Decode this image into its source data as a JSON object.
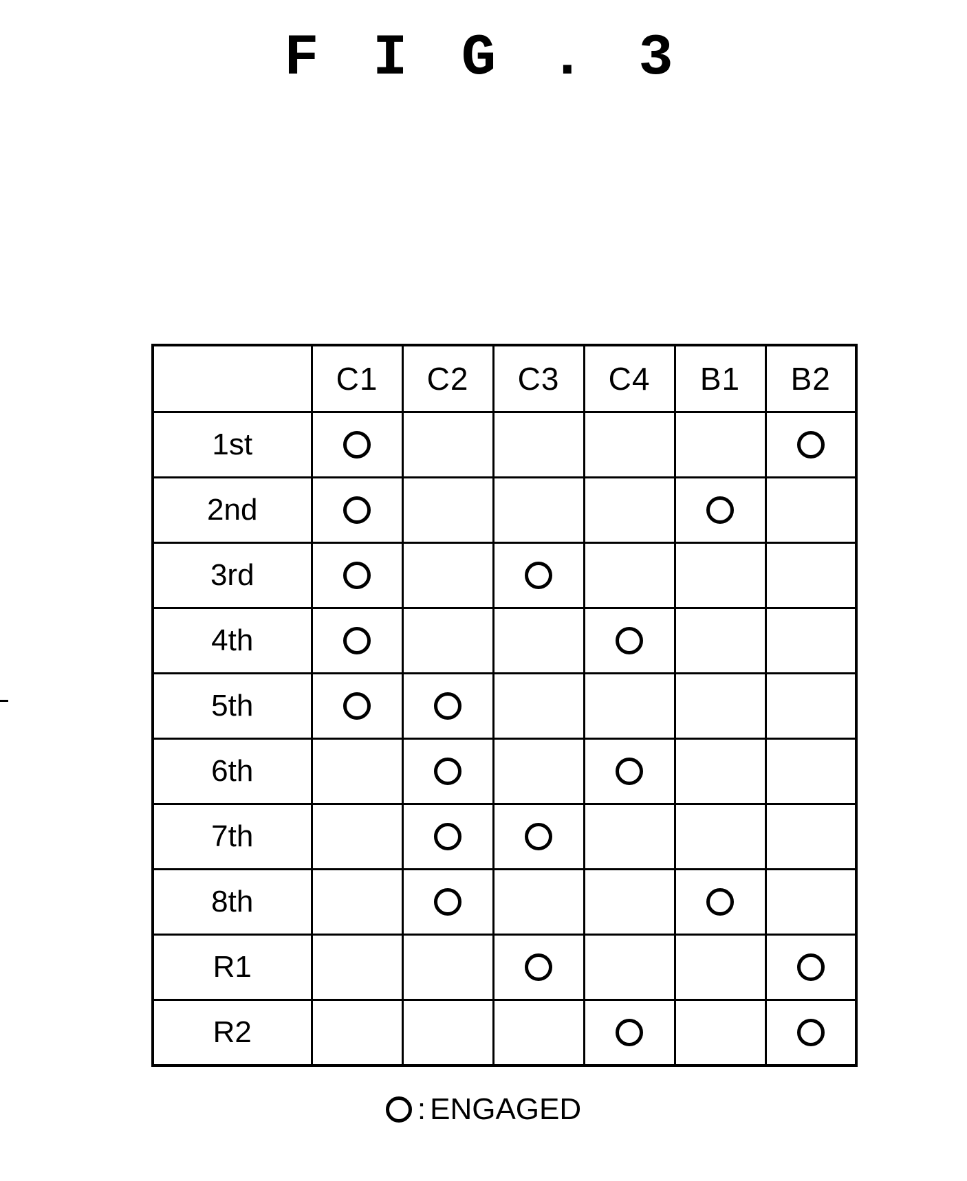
{
  "figure": {
    "title": "F I G . 3"
  },
  "table": {
    "corner_label": "",
    "columns": [
      "C1",
      "C2",
      "C3",
      "C4",
      "B1",
      "B2"
    ],
    "rows": [
      {
        "label": "1st",
        "engaged": [
          "C1",
          "B2"
        ]
      },
      {
        "label": "2nd",
        "engaged": [
          "C1",
          "B1"
        ]
      },
      {
        "label": "3rd",
        "engaged": [
          "C1",
          "C3"
        ]
      },
      {
        "label": "4th",
        "engaged": [
          "C1",
          "C4"
        ]
      },
      {
        "label": "5th",
        "engaged": [
          "C1",
          "C2"
        ]
      },
      {
        "label": "6th",
        "engaged": [
          "C2",
          "C4"
        ]
      },
      {
        "label": "7th",
        "engaged": [
          "C2",
          "C3"
        ]
      },
      {
        "label": "8th",
        "engaged": [
          "C2",
          "B1"
        ]
      },
      {
        "label": "R1",
        "engaged": [
          "C3",
          "B2"
        ]
      },
      {
        "label": "R2",
        "engaged": [
          "C4",
          "B2"
        ]
      }
    ],
    "cells": [
      [
        "O",
        "",
        "",
        "",
        "",
        "O"
      ],
      [
        "O",
        "",
        "",
        "",
        "O",
        ""
      ],
      [
        "O",
        "",
        "O",
        "",
        "",
        ""
      ],
      [
        "O",
        "",
        "",
        "O",
        "",
        ""
      ],
      [
        "O",
        "O",
        "",
        "",
        "",
        ""
      ],
      [
        "",
        "O",
        "",
        "O",
        "",
        ""
      ],
      [
        "",
        "O",
        "O",
        "",
        "",
        ""
      ],
      [
        "",
        "O",
        "",
        "",
        "O",
        ""
      ],
      [
        "",
        "",
        "O",
        "",
        "",
        "O"
      ],
      [
        "",
        "",
        "",
        "O",
        "",
        "O"
      ]
    ]
  },
  "legend": {
    "symbol": "O",
    "separator": ":",
    "text": "ENGAGED"
  },
  "colors": {
    "ink": "#000000",
    "paper": "#ffffff"
  }
}
